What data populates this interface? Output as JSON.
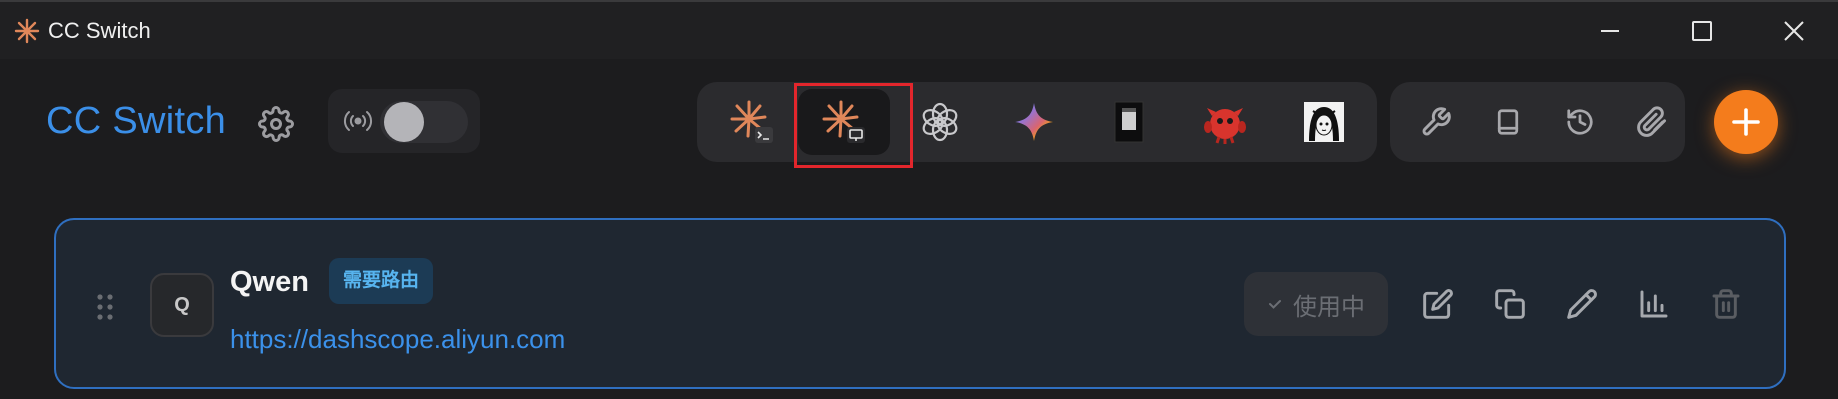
{
  "window": {
    "title": "CC Switch",
    "controls": [
      "minimize",
      "maximize",
      "close"
    ]
  },
  "header": {
    "brand": "CC Switch",
    "proxy_toggle": {
      "state": "off"
    },
    "apps": [
      {
        "icon": "claude-code-icon",
        "active": false
      },
      {
        "icon": "claude-desktop-icon",
        "active": true
      },
      {
        "icon": "openai-icon",
        "active": false
      },
      {
        "icon": "gemini-icon",
        "active": false
      },
      {
        "icon": "opencode-icon",
        "active": false
      },
      {
        "icon": "red-mascot-icon",
        "active": false
      },
      {
        "icon": "anime-avatar-icon",
        "active": false
      }
    ],
    "tools": [
      "wrench-icon",
      "book-icon",
      "history-icon",
      "paperclip-icon"
    ]
  },
  "provider": {
    "avatar_letter": "Q",
    "name": "Qwen",
    "badge": "需要路由",
    "url": "https://dashscope.aliyun.com",
    "in_use_label": "使用中"
  },
  "colors": {
    "accent_blue": "#3b8fe8",
    "add_orange": "#f47c1c",
    "highlight_red": "#e3262c",
    "card_border": "#2f6fc0"
  }
}
